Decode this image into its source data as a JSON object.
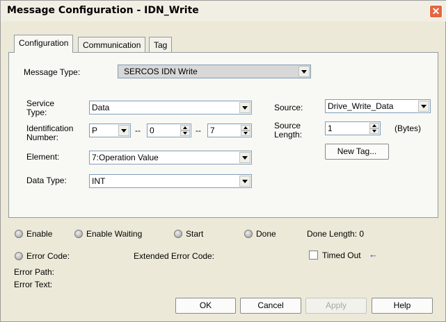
{
  "window": {
    "title": "Message Configuration - IDN_Write",
    "close_glyph": "✕"
  },
  "tabs": [
    {
      "label": "Configuration",
      "active": true
    },
    {
      "label": "Communication",
      "active": false
    },
    {
      "label": "Tag",
      "active": false
    }
  ],
  "config": {
    "message_type_label": "Message Type:",
    "message_type_value": "SERCOS IDN Write",
    "service_type_label": "Service\nType:",
    "service_type_value": "Data",
    "ident_label": "Identification\nNumber:",
    "ident_p": "P",
    "ident_set": "0",
    "ident_num": "7",
    "ident_dash": "--",
    "element_label": "Element:",
    "element_value": "7:Operation Value",
    "data_type_label": "Data Type:",
    "data_type_value": "INT",
    "source_label": "Source:",
    "source_value": "Drive_Write_Data",
    "source_length_label": "Source\nLength:",
    "source_length_value": "1",
    "bytes_label": "(Bytes)",
    "new_tag_button": "New Tag..."
  },
  "status": {
    "enable": "Enable",
    "enable_waiting": "Enable Waiting",
    "start": "Start",
    "done": "Done",
    "done_length": "Done Length: 0",
    "error_code": "Error Code:",
    "extended_error_code": "Extended Error Code:",
    "timed_out": "Timed Out",
    "timed_out_checked": false,
    "error_path": "Error Path:",
    "error_text": "Error Text:",
    "arrow_glyph": "←"
  },
  "buttons": {
    "ok": "OK",
    "cancel": "Cancel",
    "apply": "Apply",
    "help": "Help"
  }
}
